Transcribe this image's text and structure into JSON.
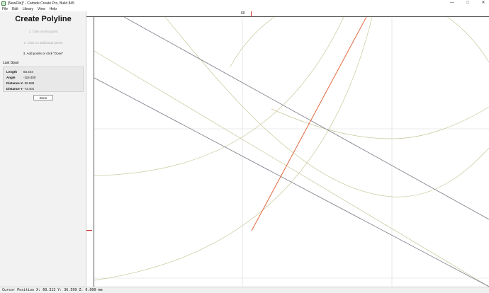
{
  "window": {
    "title": "[NewFile]* - Carbide Create Pro, Build 845",
    "minimize": "—",
    "maximize": "□",
    "close": "✕"
  },
  "menu": [
    "File",
    "Edit",
    "Library",
    "View",
    "Help"
  ],
  "panel": {
    "title": "Create Polyline",
    "steps": [
      "1. Click on first point",
      "2. Click on additional points",
      "3. Add points or click \"Done\""
    ],
    "last_span_label": "Last Span",
    "span": {
      "length_label": "Length",
      "length_value": "83.444",
      "angle_label": "Angle",
      "angle_value": "-118.400",
      "dx_label": "Distance X",
      "dx_value": "-39.688",
      "dy_label": "Distance Y",
      "dy_value": "-73.401"
    },
    "done_label": "Done"
  },
  "ruler": {
    "top_label": "60"
  },
  "status": "Cursor Position X: 60.313 Y: 36.599 Z: 0.000 mm",
  "colors": {
    "polyline": "#e2683f",
    "guide_dark": "#7a7a88",
    "guide_olive": "#c9c79a",
    "grid": "#d7d7d7",
    "ruler_marker": "#d0302a"
  },
  "icons": {
    "app": "carbide-create-icon"
  }
}
